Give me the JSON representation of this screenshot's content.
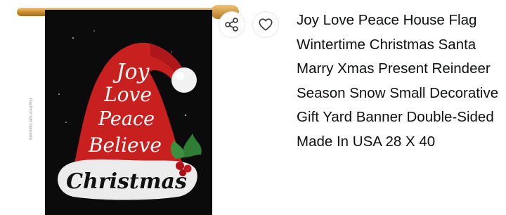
{
  "product": {
    "title": "Joy Love Peace House Flag Wintertime Christmas Santa Marry Xmas Present Reindeer Season Snow Small Decorative Gift Yard Banner Double-Sided Made In USA 28 X 40"
  },
  "image": {
    "hat_words": [
      "Joy",
      "Love",
      "Peace",
      "Believe"
    ],
    "brim_word": "Christmas",
    "side_caption": "Flag Price Sold Separately",
    "colors": {
      "flag_bg": "#0b0b0b",
      "hat_red": "#c8201e",
      "pole": "#c98c2c",
      "holly": "#2e7d32"
    }
  },
  "actions": {
    "share_icon": "share-icon",
    "wishlist_icon": "heart-outline-icon"
  }
}
